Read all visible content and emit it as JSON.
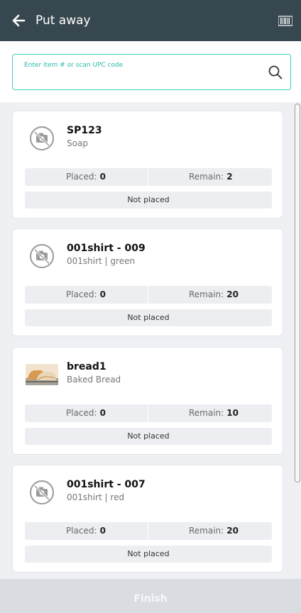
{
  "appbar": {
    "title": "Put away",
    "back_icon": "arrow-left-icon",
    "scan_icon": "barcode-icon"
  },
  "search": {
    "placeholder": "Enter item # or scan UPC code",
    "icon": "search-icon",
    "accent": "#3fcfc0"
  },
  "labels": {
    "placed": "Placed:",
    "remain": "Remain:"
  },
  "items": [
    {
      "code": "SP123",
      "name": "Soap",
      "placed": "0",
      "remain": "2",
      "status": "Not placed",
      "thumb": "no-image-icon"
    },
    {
      "code": "001shirt - 009",
      "name": "001shirt | green",
      "placed": "0",
      "remain": "20",
      "status": "Not placed",
      "thumb": "no-image-icon"
    },
    {
      "code": "bread1",
      "name": "Baked Bread",
      "placed": "0",
      "remain": "10",
      "status": "Not placed",
      "thumb": "bread-image"
    },
    {
      "code": "001shirt - 007",
      "name": "001shirt | red",
      "placed": "0",
      "remain": "20",
      "status": "Not placed",
      "thumb": "no-image-icon"
    }
  ],
  "footer": {
    "finish_label": "Finish"
  },
  "colors": {
    "appbar": "#37474f",
    "accent": "#3fcfc0",
    "background": "#eef0f4",
    "finish_disabled": "#d9dde2"
  }
}
